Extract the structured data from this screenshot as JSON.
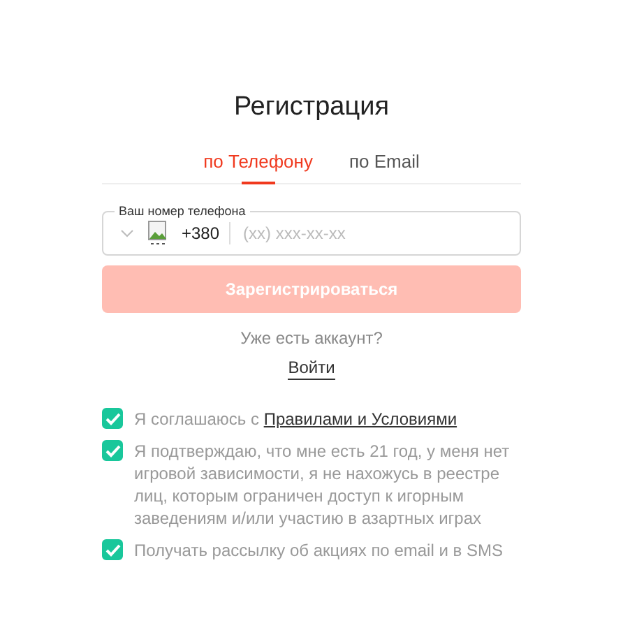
{
  "title": "Регистрация",
  "tabs": [
    {
      "label": "по Телефону",
      "selected": true
    },
    {
      "label": "по Email",
      "selected": false
    }
  ],
  "phone_field": {
    "label": "Ваш номер телефона",
    "code": "+380",
    "placeholder": "(xx) xxx-xx-xx"
  },
  "register_button": {
    "label": "Зарегистрироваться",
    "disabled": true
  },
  "login_prompt": "Уже есть аккаунт?",
  "login_link": "Войти",
  "agreements": [
    {
      "checked": true,
      "text": "Я соглашаюсь с ",
      "link": "Правилами и Условиями"
    },
    {
      "checked": true,
      "text": "Я подтверждаю, что мне есть 21 год, у меня нет игровой зависимости, я не нахожусь в реестре лиц, которым ограничен доступ к игорным заведениям и/или участию в азартных играх"
    },
    {
      "checked": true,
      "text": "Получать рассылку об акциях по email и в SMS"
    }
  ]
}
